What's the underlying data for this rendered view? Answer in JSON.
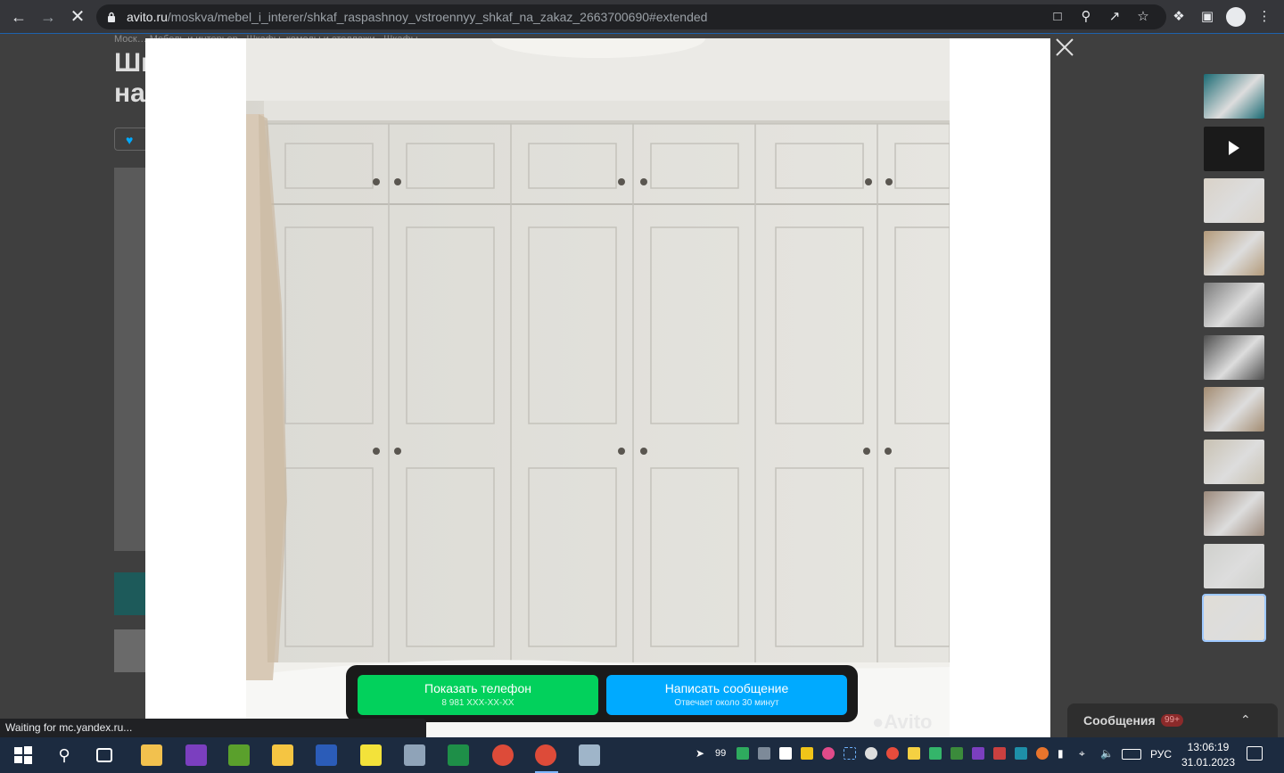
{
  "browser": {
    "url_host": "avito.ru",
    "url_path": "/moskva/mebel_i_interer/shkaf_raspashnoy_vstroennyy_shkaf_na_zakaz_2663700690#extended",
    "status_text": "Waiting for mc.yandex.ru..."
  },
  "background": {
    "breadcrumb": "Моск…     Мебель и интерьер · Шкафы, комоды и стеллажи · Шкафы",
    "title_line1": "Шк",
    "title_line2": "на"
  },
  "cta": {
    "phone_label": "Показать телефон",
    "phone_number": "8 981 XXX-XX-XX",
    "message_label": "Написать сообщение",
    "message_sub": "Отвечает около 30 минут"
  },
  "watermark": "Avito",
  "messages": {
    "label": "Сообщения",
    "badge": "99+"
  },
  "taskbar": {
    "language": "РУС",
    "time": "13:06:19",
    "date": "31.01.2023",
    "tray_count": "99"
  },
  "thumbnails": [
    {
      "name": "thumb-1",
      "color": "#1b6b74"
    },
    {
      "name": "thumb-2-video",
      "color": "#1a1a1a"
    },
    {
      "name": "thumb-3",
      "color": "#d9d2c8"
    },
    {
      "name": "thumb-4",
      "color": "#b39a7a"
    },
    {
      "name": "thumb-5",
      "color": "#7a7a7a"
    },
    {
      "name": "thumb-6",
      "color": "#4e4e4e"
    },
    {
      "name": "thumb-7",
      "color": "#a38c72"
    },
    {
      "name": "thumb-8",
      "color": "#c8c1b2"
    },
    {
      "name": "thumb-9",
      "color": "#9c8a7c"
    },
    {
      "name": "thumb-10",
      "color": "#cfd0cc"
    },
    {
      "name": "thumb-11",
      "color": "#e0ddd6"
    }
  ]
}
